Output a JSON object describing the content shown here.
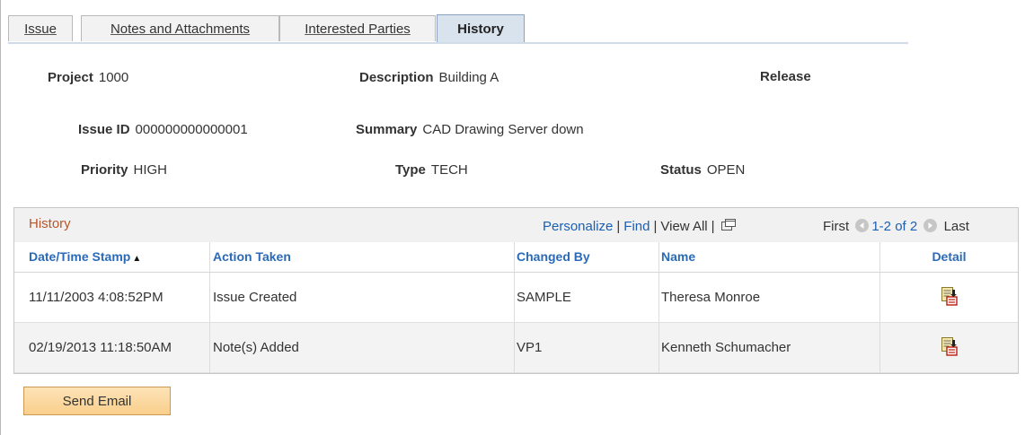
{
  "tabs": [
    {
      "label": "Issue",
      "active": false
    },
    {
      "label": "Notes and Attachments",
      "active": false
    },
    {
      "label": "Interested Parties",
      "active": false
    },
    {
      "label": "History",
      "active": true
    }
  ],
  "header": {
    "project_label": "Project",
    "project_value": "1000",
    "description_label": "Description",
    "description_value": "Building A",
    "release_label": "Release",
    "issue_id_label": "Issue ID",
    "issue_id_value": "000000000000001",
    "summary_label": "Summary",
    "summary_value": "CAD Drawing Server down",
    "priority_label": "Priority",
    "priority_value": "HIGH",
    "type_label": "Type",
    "type_value": "TECH",
    "status_label": "Status",
    "status_value": "OPEN"
  },
  "grid": {
    "title": "History",
    "personalize": "Personalize",
    "find": "Find",
    "view_all": "View All",
    "first": "First",
    "range": "1-2 of 2",
    "last": "Last",
    "columns": [
      "Date/Time Stamp",
      "Action Taken",
      "Changed By",
      "Name",
      "Detail"
    ],
    "sort_indicator": "▲",
    "rows": [
      {
        "timestamp": "11/11/2003  4:08:52PM",
        "action": "Issue Created",
        "changed_by": "SAMPLE",
        "name": "Theresa Monroe"
      },
      {
        "timestamp": "02/19/2013 11:18:50AM",
        "action": "Note(s) Added",
        "changed_by": "VP1",
        "name": "Kenneth Schumacher"
      }
    ],
    "icons": {
      "detail": "detail-document-icon",
      "popout": "popout-icon",
      "prev": "prev-arrow-icon",
      "next": "next-arrow-icon"
    }
  },
  "buttons": {
    "send_email": "Send Email"
  },
  "colors": {
    "link": "#1a5fb4",
    "grid_title": "#b5572a",
    "active_tab": "#d9e3ee",
    "button": "#f9cf8c"
  }
}
